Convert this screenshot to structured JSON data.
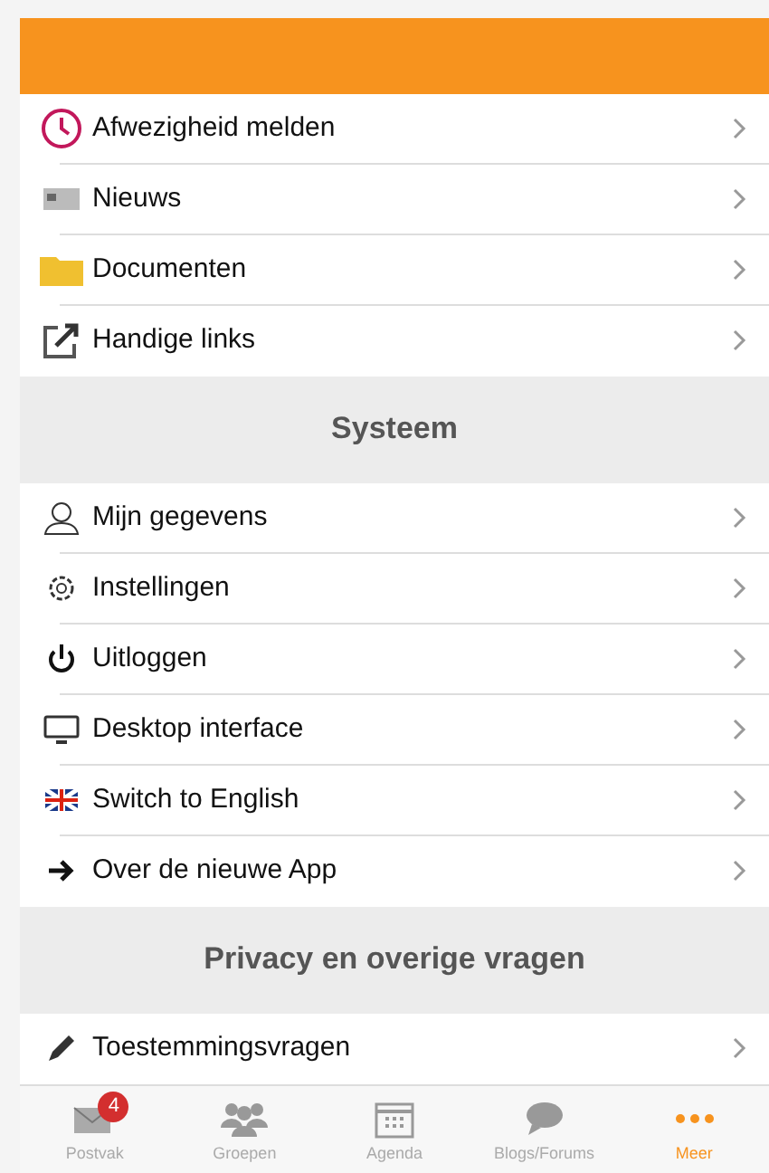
{
  "sections": [
    {
      "items": [
        {
          "label": "Afwezigheid melden"
        },
        {
          "label": "Nieuws"
        },
        {
          "label": "Documenten"
        },
        {
          "label": "Handige links"
        }
      ]
    },
    {
      "title": "Systeem",
      "items": [
        {
          "label": "Mijn gegevens"
        },
        {
          "label": "Instellingen"
        },
        {
          "label": "Uitloggen"
        },
        {
          "label": "Desktop interface"
        },
        {
          "label": "Switch to English"
        },
        {
          "label": "Over de nieuwe App"
        }
      ]
    },
    {
      "title": "Privacy en overige vragen",
      "items": [
        {
          "label": "Toestemmingsvragen"
        }
      ]
    }
  ],
  "tab_bar": [
    {
      "label": "Postvak",
      "badge": "4",
      "selected": false
    },
    {
      "label": "Groepen",
      "selected": false
    },
    {
      "label": "Agenda",
      "selected": false
    },
    {
      "label": "Blogs/Forums",
      "selected": false
    },
    {
      "label": "Meer",
      "selected": true
    }
  ]
}
